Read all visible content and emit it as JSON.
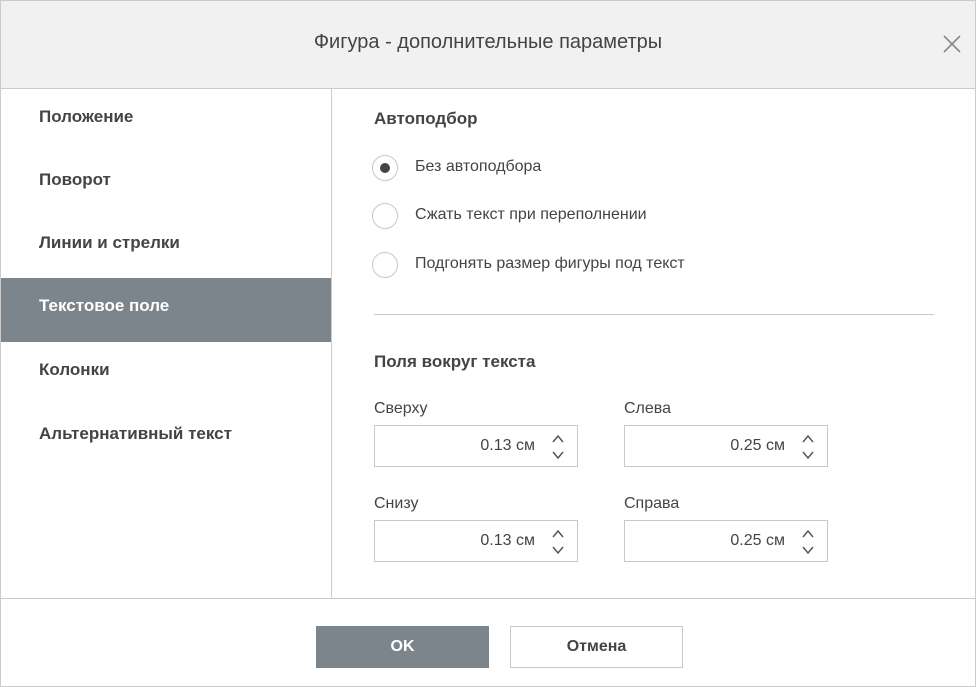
{
  "dialog": {
    "title": "Фигура - дополнительные параметры"
  },
  "sidebar": {
    "items": [
      {
        "label": "Положение",
        "active": false
      },
      {
        "label": "Поворот",
        "active": false
      },
      {
        "label": "Линии и стрелки",
        "active": false
      },
      {
        "label": "Текстовое поле",
        "active": true
      },
      {
        "label": "Колонки",
        "active": false
      },
      {
        "label": "Альтернативный текст",
        "active": false
      }
    ]
  },
  "autofit": {
    "title": "Автоподбор",
    "options": [
      {
        "label": "Без автоподбора",
        "checked": true
      },
      {
        "label": "Сжать текст при переполнении",
        "checked": false
      },
      {
        "label": "Подгонять размер фигуры под текст",
        "checked": false
      }
    ]
  },
  "margins": {
    "title": "Поля вокруг текста",
    "top": {
      "label": "Сверху",
      "value": "0.13 см"
    },
    "left": {
      "label": "Слева",
      "value": "0.25 см"
    },
    "bottom": {
      "label": "Снизу",
      "value": "0.13 см"
    },
    "right": {
      "label": "Справа",
      "value": "0.25 см"
    }
  },
  "footer": {
    "ok_label": "OK",
    "cancel_label": "Отмена"
  },
  "colors": {
    "accent": "#7d858c",
    "header_bg": "#f1f1f1",
    "border": "#cbcbcb",
    "text": "#444444"
  }
}
